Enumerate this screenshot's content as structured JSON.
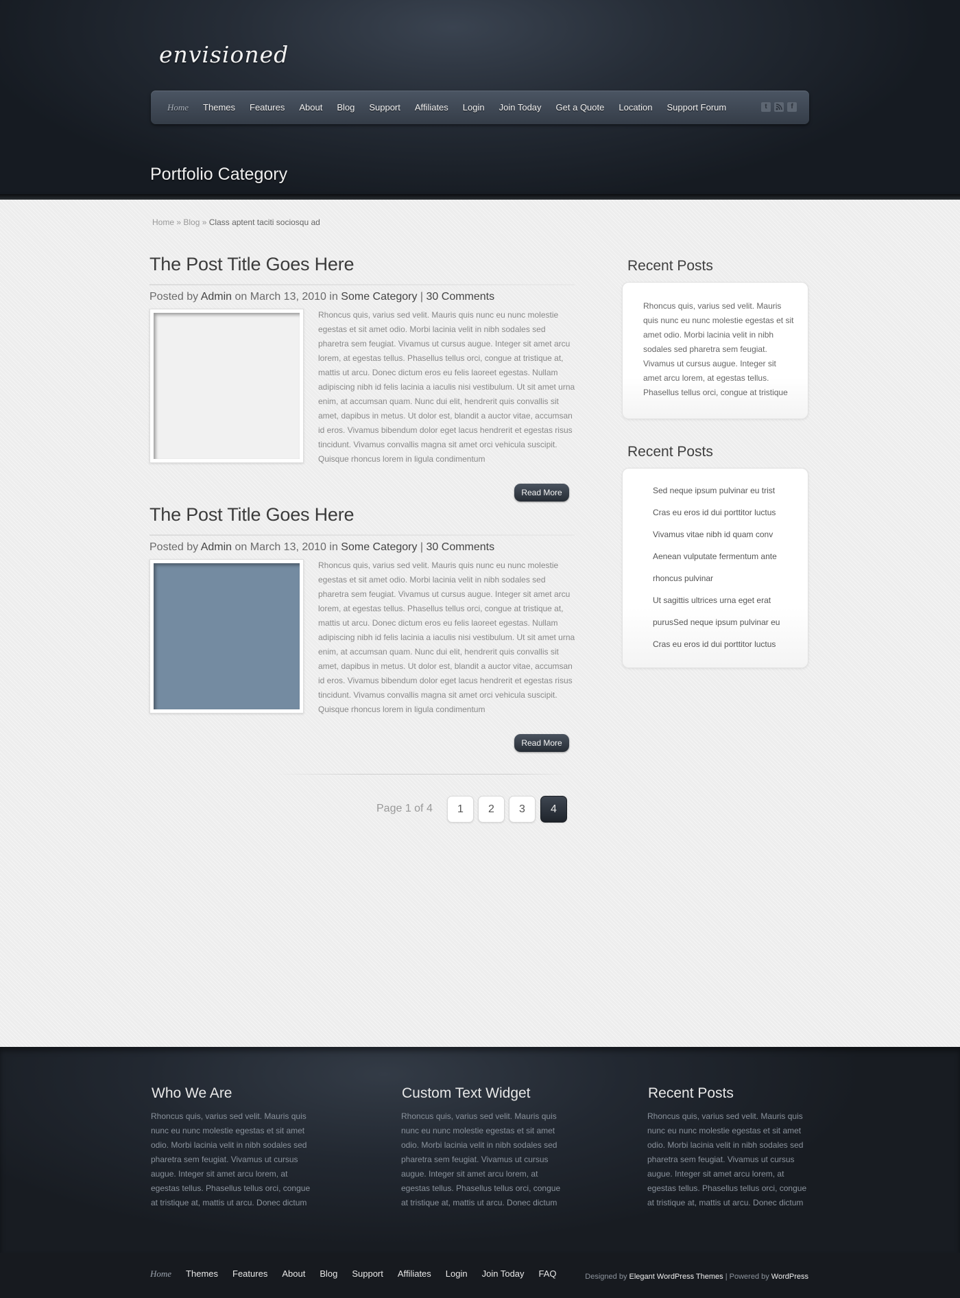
{
  "header": {
    "logo": "envisioned",
    "nav": [
      "Home",
      "Themes",
      "Features",
      "About",
      "Blog",
      "Support",
      "Affiliates",
      "Login",
      "Join Today",
      "Get a Quote",
      "Location",
      "Support Forum"
    ],
    "social_icons": [
      "twitter-icon",
      "rss-icon",
      "facebook-icon"
    ],
    "page_title": "Portfolio Category"
  },
  "breadcrumb": {
    "home": "Home",
    "sep1": " » ",
    "blog": "Blog",
    "sep2": " » ",
    "current": "Class aptent taciti sociosqu ad"
  },
  "posts": [
    {
      "title": "The Post Title Goes Here",
      "meta_prefix": "Posted by ",
      "author": "Admin",
      "meta_mid1": " on ",
      "date": "March 13, 2010",
      "meta_mid2": " in ",
      "category": "Some Category",
      "meta_sep": " | ",
      "comments": "30 Comments",
      "excerpt": "Rhoncus quis, varius sed velit. Mauris quis nunc eu nunc molestie egestas et sit amet odio. Morbi lacinia velit in nibh sodales sed pharetra sem feugiat. Vivamus ut cursus augue. Integer sit amet arcu lorem, at egestas tellus. Phasellus tellus orci, congue at tristique at, mattis ut arcu. Donec dictum eros eu felis laoreet egestas. Nullam adipiscing nibh id felis lacinia a iaculis nisi vestibulum. Ut sit amet urna enim, at accumsan quam. Nunc dui elit, hendrerit quis convallis sit amet, dapibus in metus. Ut dolor est, blandit a auctor vitae, accumsan id eros. Vivamus bibendum dolor eget lacus hendrerit et egestas risus tincidunt. Vivamus convallis magna sit amet orci vehicula suscipit. Quisque rhoncus lorem in ligula condimentum",
      "read_more": "Read More"
    },
    {
      "title": "The Post Title Goes Here",
      "meta_prefix": "Posted by ",
      "author": "Admin",
      "meta_mid1": " on ",
      "date": "March 13, 2010",
      "meta_mid2": " in ",
      "category": "Some Category",
      "meta_sep": " | ",
      "comments": "30 Comments",
      "excerpt": "Rhoncus quis, varius sed velit. Mauris quis nunc eu nunc molestie egestas et sit amet odio. Morbi lacinia velit in nibh sodales sed pharetra sem feugiat. Vivamus ut cursus augue. Integer sit amet arcu lorem, at egestas tellus. Phasellus tellus orci, congue at tristique at, mattis ut arcu. Donec dictum eros eu felis laoreet egestas. Nullam adipiscing nibh id felis lacinia a iaculis nisi vestibulum. Ut sit amet urna enim, at accumsan quam. Nunc dui elit, hendrerit quis convallis sit amet, dapibus in metus. Ut dolor est, blandit a auctor vitae, accumsan id eros. Vivamus bibendum dolor eget lacus hendrerit et egestas risus tincidunt. Vivamus convallis magna sit amet orci vehicula suscipit. Quisque rhoncus lorem in ligula condimentum",
      "read_more": "Read More"
    }
  ],
  "pagination": {
    "label": "Page 1 of 4",
    "pages": [
      "1",
      "2",
      "3",
      "4"
    ],
    "active_color": "#2b3139"
  },
  "sidebar": {
    "widget1": {
      "title": "Recent Posts",
      "text": "Rhoncus quis, varius sed velit. Mauris quis nunc eu nunc molestie egestas et sit amet odio. Morbi lacinia velit in nibh sodales sed pharetra sem feugiat. Vivamus ut cursus augue. Integer sit amet arcu lorem, at egestas tellus. Phasellus tellus orci, congue at tristique"
    },
    "widget2": {
      "title": "Recent Posts",
      "items": [
        "Sed neque ipsum pulvinar eu trist",
        "Cras eu eros id dui porttitor luctus",
        "Vivamus vitae nibh id quam conv",
        "Aenean vulputate fermentum ante",
        "rhoncus pulvinar",
        "Ut sagittis ultrices urna eget erat",
        "purusSed neque ipsum pulvinar eu",
        "Cras eu eros id dui porttitor luctus"
      ]
    }
  },
  "footer": {
    "col1": {
      "title": "Who We Are",
      "text": "Rhoncus quis, varius sed velit. Mauris quis nunc eu nunc molestie egestas et sit amet odio. Morbi lacinia velit in nibh sodales sed pharetra sem feugiat. Vivamus ut cursus augue. Integer sit amet arcu lorem, at egestas tellus. Phasellus tellus orci, congue at tristique at, mattis ut arcu. Donec dictum"
    },
    "col2": {
      "title": "Custom Text Widget",
      "text": "Rhoncus quis, varius sed velit. Mauris quis nunc eu nunc molestie egestas et sit amet odio. Morbi lacinia velit in nibh sodales sed pharetra sem feugiat. Vivamus ut cursus augue. Integer sit amet arcu lorem, at egestas tellus. Phasellus tellus orci, congue at tristique at, mattis ut arcu. Donec dictum"
    },
    "col3": {
      "title": "Recent Posts",
      "text": "Rhoncus quis, varius sed velit. Mauris quis nunc eu nunc molestie egestas et sit amet odio. Morbi lacinia velit in nibh sodales sed pharetra sem feugiat. Vivamus ut cursus augue. Integer sit amet arcu lorem, at egestas tellus. Phasellus tellus orci, congue at tristique at, mattis ut arcu. Donec dictum"
    },
    "bottom_nav": [
      "Home",
      "Themes",
      "Features",
      "About",
      "Blog",
      "Support",
      "Affiliates",
      "Login",
      "Join Today",
      "FAQ"
    ],
    "credits": {
      "designed_by": "Designed by ",
      "designer": "Elegant WordPress Themes",
      "sep": " | Powered by ",
      "powered": "WordPress"
    }
  }
}
